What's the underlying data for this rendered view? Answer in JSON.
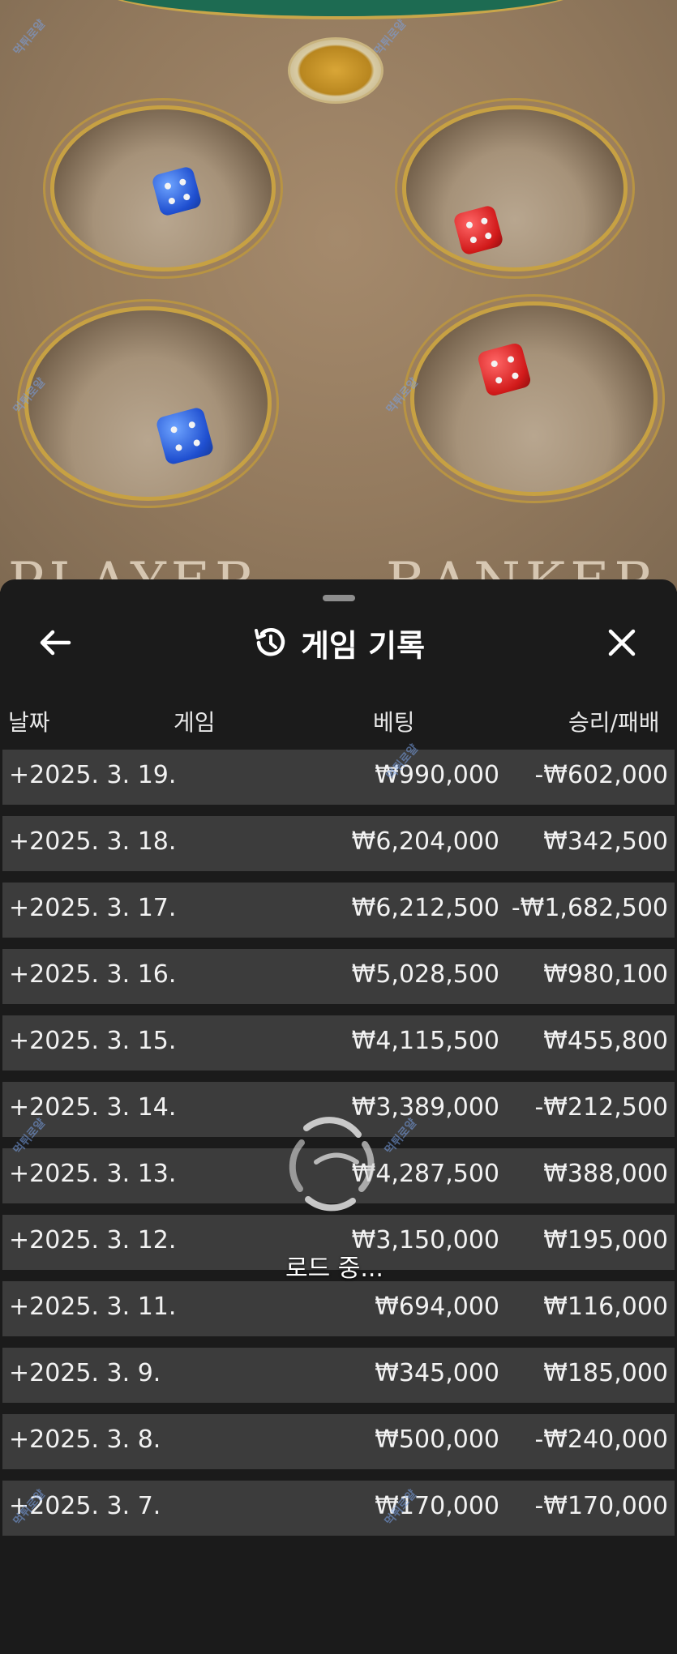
{
  "scene": {
    "label_left": "PLAYER",
    "label_right": "BANKER"
  },
  "watermark": "먹튀로얄",
  "header": {
    "title": "게임 기록",
    "back_icon": "arrow-left-icon",
    "history_icon": "history-clock-icon",
    "close_icon": "close-icon"
  },
  "columns": {
    "date": "날짜",
    "game": "게임",
    "bet": "베팅",
    "win_loss": "승리/패배"
  },
  "rows": [
    {
      "date": "+2025. 3. 19.",
      "bet": "₩990,000",
      "win_loss": "-₩602,000"
    },
    {
      "date": "+2025. 3. 18.",
      "bet": "₩6,204,000",
      "win_loss": "₩342,500"
    },
    {
      "date": "+2025. 3. 17.",
      "bet": "₩6,212,500",
      "win_loss": "-₩1,682,500"
    },
    {
      "date": "+2025. 3. 16.",
      "bet": "₩5,028,500",
      "win_loss": "₩980,100"
    },
    {
      "date": "+2025. 3. 15.",
      "bet": "₩4,115,500",
      "win_loss": "₩455,800"
    },
    {
      "date": "+2025. 3. 14.",
      "bet": "₩3,389,000",
      "win_loss": "-₩212,500"
    },
    {
      "date": "+2025. 3. 13.",
      "bet": "₩4,287,500",
      "win_loss": "₩388,000"
    },
    {
      "date": "+2025. 3. 12.",
      "bet": "₩3,150,000",
      "win_loss": "₩195,000"
    },
    {
      "date": "+2025. 3. 11.",
      "bet": "₩694,000",
      "win_loss": "₩116,000"
    },
    {
      "date": "+2025. 3. 9.",
      "bet": "₩345,000",
      "win_loss": "₩185,000"
    },
    {
      "date": "+2025. 3. 8.",
      "bet": "₩500,000",
      "win_loss": "-₩240,000"
    },
    {
      "date": "+2025. 3. 7.",
      "bet": "₩170,000",
      "win_loss": "-₩170,000"
    }
  ],
  "loading": {
    "text": "로드 중..."
  },
  "colors": {
    "sheet_bg": "#1b1b1b",
    "row_bg": "#3c3c3c",
    "text": "#ffffff",
    "table_felt": "#937a5e",
    "dice_blue": "#1f4fd0",
    "dice_red": "#d11a1a"
  }
}
